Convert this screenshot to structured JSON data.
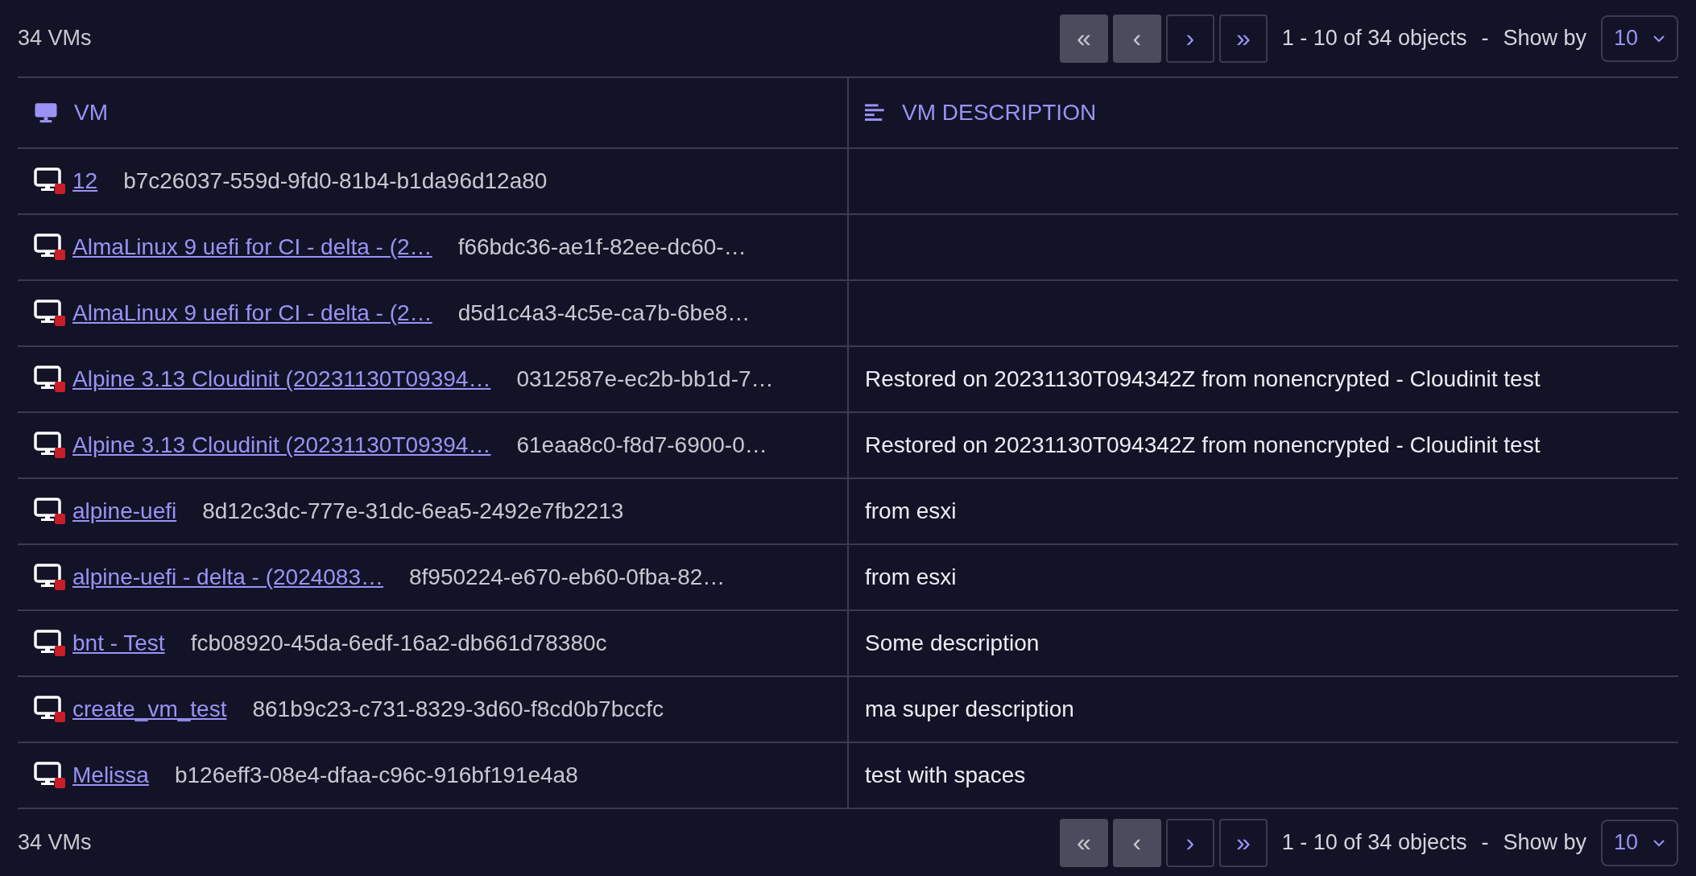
{
  "top_bar": {
    "count": "34 VMs",
    "pager": [
      {
        "label": "«",
        "disabled": true
      },
      {
        "label": "‹",
        "disabled": true
      },
      {
        "label": "›",
        "disabled": false
      },
      {
        "label": "»",
        "disabled": false
      }
    ],
    "range": "1 - 10 of 34 objects",
    "separator": "-",
    "show_by_label": "Show by",
    "show_by_value": "10"
  },
  "table": {
    "columns": [
      {
        "label": "VM",
        "kind": "vm"
      },
      {
        "label": "VM DESCRIPTION",
        "kind": "description"
      }
    ],
    "rows": [
      {
        "name": "12",
        "id": "b7c26037-559d-9fd0-81b4-b1da96d12a80",
        "running": false
      },
      {
        "name": "AlmaLinux 9 uefi for CI - delta - (2…",
        "id": "f66bdc36-ae1f-82ee-dc60-…",
        "running": false
      },
      {
        "name": "AlmaLinux 9 uefi for CI - delta - (2…",
        "id": "d5d1c4a3-4c5e-ca7b-6be8…",
        "running": false
      },
      {
        "name": "Alpine 3.13 Cloudinit (20231130T09394…",
        "id": "0312587e-ec2b-bb1d-7…",
        "running": false,
        "description": "Restored on 20231130T094342Z from nonencrypted - Cloudinit test"
      },
      {
        "name": "Alpine 3.13 Cloudinit (20231130T09394…",
        "id": "61eaa8c0-f8d7-6900-0…",
        "running": false,
        "description": "Restored on 20231130T094342Z from nonencrypted - Cloudinit test"
      },
      {
        "name": "alpine-uefi",
        "id": "8d12c3dc-777e-31dc-6ea5-2492e7fb2213",
        "running": false,
        "description": "from esxi"
      },
      {
        "name": "alpine-uefi - delta - (2024083…",
        "id": "8f950224-e670-eb60-0fba-82…",
        "running": false,
        "description": "from esxi"
      },
      {
        "name": "bnt - Test",
        "id": "fcb08920-45da-6edf-16a2-db661d78380c",
        "running": false,
        "description": "Some description"
      },
      {
        "name": "create_vm_test",
        "id": "861b9c23-c731-8329-3d60-f8cd0b7bccfc",
        "running": false,
        "description": "ma super description"
      },
      {
        "name": "Melissa",
        "id": "b126eff3-08e4-dfaa-c96c-916bf191e4a8",
        "running": false,
        "description": "test with spaces"
      }
    ]
  },
  "bottom_bar": {
    "count": "34 VMs",
    "pager": [
      {
        "label": "«",
        "disabled": true
      },
      {
        "label": "‹",
        "disabled": true
      },
      {
        "label": "›",
        "disabled": false
      },
      {
        "label": "»",
        "disabled": false
      }
    ],
    "range": "1 - 10 of 34 objects",
    "separator": "-",
    "show_by_label": "Show by",
    "show_by_value": "10"
  }
}
